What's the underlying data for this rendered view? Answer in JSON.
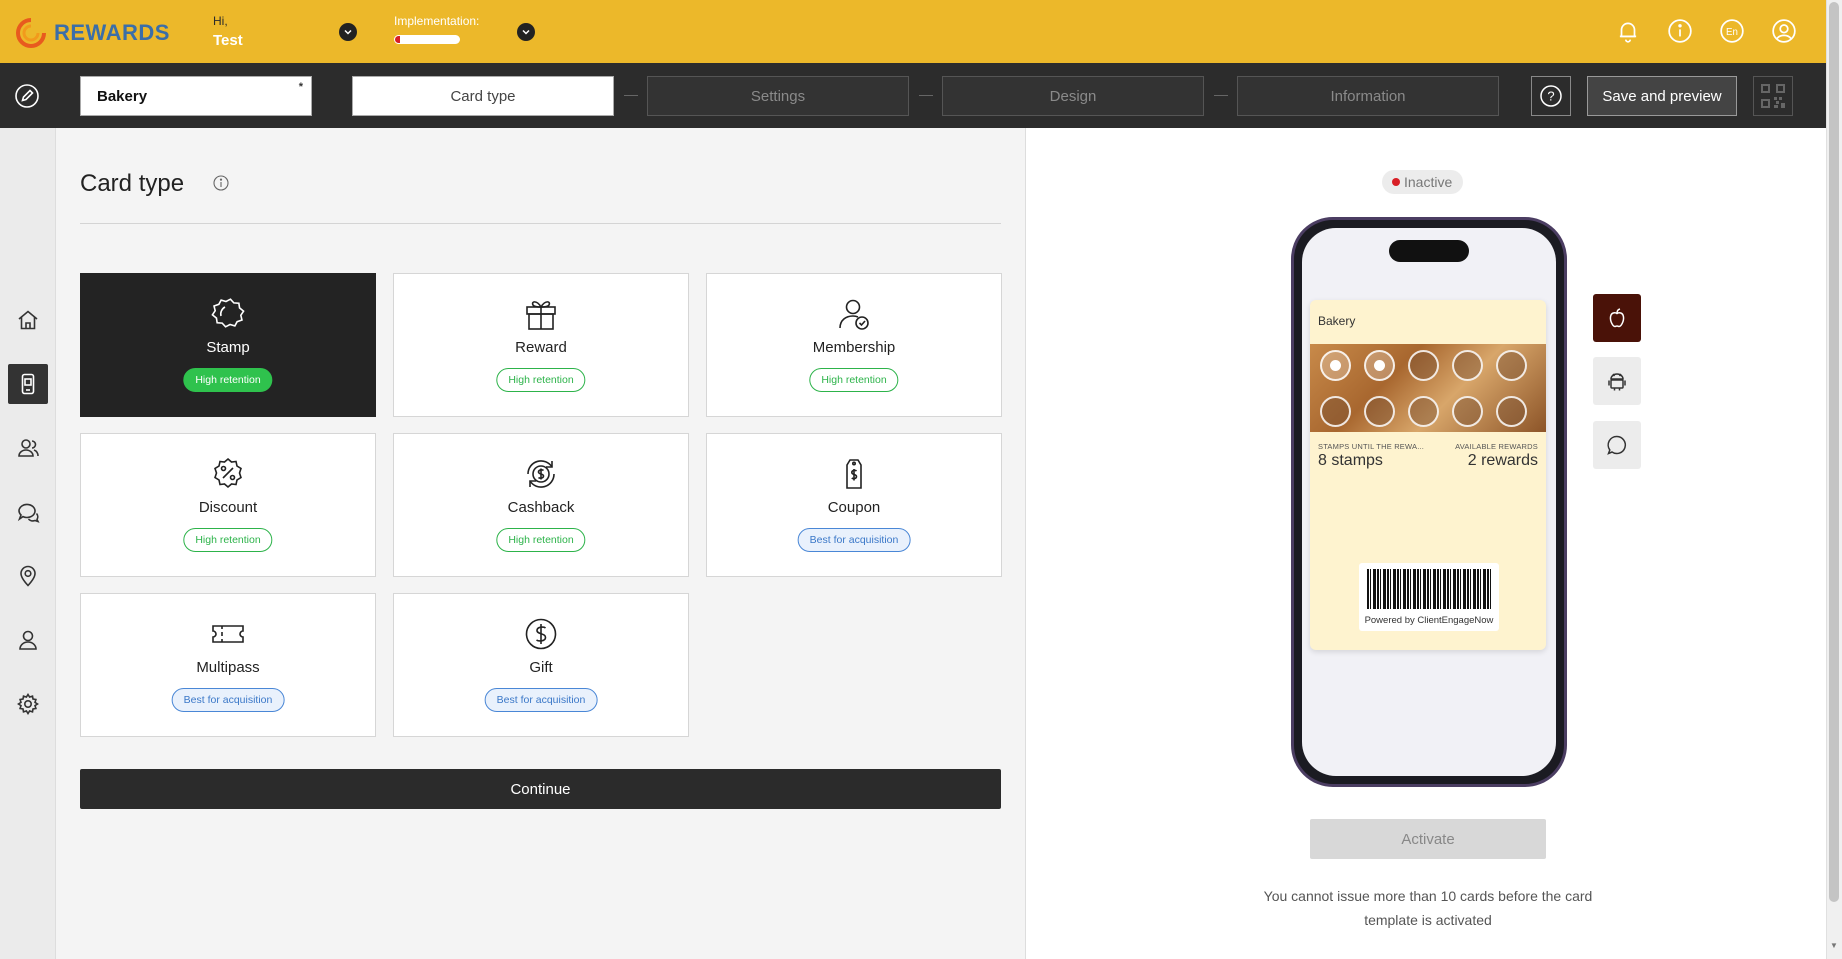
{
  "header": {
    "brand": "REWARDS",
    "greeting": "Hi,",
    "user_name": "Test",
    "implementation_label": "Implementation:",
    "implementation_progress": 0.08,
    "language": "En",
    "icons": [
      "bell-icon",
      "info-icon",
      "language-icon",
      "user-icon"
    ]
  },
  "toolbar": {
    "card_name": "Bakery",
    "card_name_marker": "*",
    "steps": [
      "Card type",
      "Settings",
      "Design",
      "Information"
    ],
    "active_step": "Card type",
    "help_label": "?",
    "save_label": "Save and preview"
  },
  "sidebar": {
    "items": [
      "home",
      "cards",
      "clients",
      "messages",
      "locations",
      "staff",
      "settings"
    ],
    "active": "cards"
  },
  "main": {
    "title": "Card type",
    "tiles": [
      {
        "label": "Stamp",
        "badge": "High retention",
        "icon": "stamp-icon",
        "selected": true
      },
      {
        "label": "Reward",
        "badge": "High retention",
        "icon": "gift-box-icon",
        "selected": false
      },
      {
        "label": "Membership",
        "badge": "High retention",
        "icon": "membership-icon",
        "selected": false
      },
      {
        "label": "Discount",
        "badge": "High retention",
        "icon": "discount-icon",
        "selected": false
      },
      {
        "label": "Cashback",
        "badge": "High retention",
        "icon": "cashback-icon",
        "selected": false
      },
      {
        "label": "Coupon",
        "badge": "Best for acquisition",
        "icon": "coupon-icon",
        "selected": false
      },
      {
        "label": "Multipass",
        "badge": "Best for acquisition",
        "icon": "ticket-icon",
        "selected": false
      },
      {
        "label": "Gift",
        "badge": "Best for acquisition",
        "icon": "dollar-icon",
        "selected": false
      }
    ],
    "continue_label": "Continue"
  },
  "preview": {
    "status": "Inactive",
    "status_color": "#d81f26",
    "pass": {
      "title": "Bakery",
      "stamps_total": 10,
      "stamps_filled": 2,
      "label_left": "STAMPS UNTIL THE REWA...",
      "value_left": "8 stamps",
      "label_right": "AVAILABLE REWARDS",
      "value_right": "2 rewards",
      "powered_by": "Powered by ClientEngageNow"
    },
    "platforms": [
      "apple-icon",
      "android-icon",
      "chat-icon"
    ],
    "active_platform": "apple-icon",
    "activate_label": "Activate",
    "activate_note": "You cannot issue more than 10 cards before the card template is activated"
  },
  "colors": {
    "brand_yellow": "#ecb82a",
    "dark": "#2c2c2c",
    "retention_green": "#2db34a",
    "acquisition_blue": "#3b78c8",
    "apple_active": "#4a1208"
  }
}
